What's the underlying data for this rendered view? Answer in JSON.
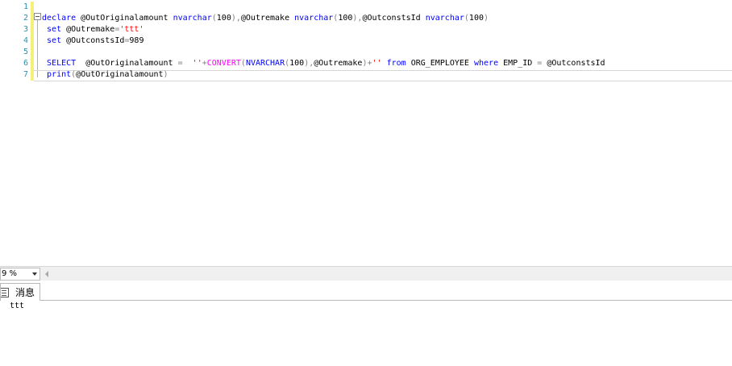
{
  "editor": {
    "line_numbers": [
      "1",
      "2",
      "3",
      "4",
      "5",
      "6",
      "7"
    ],
    "lines": [
      {
        "segments": []
      },
      {
        "segments": [
          {
            "t": "kw",
            "v": "declare"
          },
          {
            "t": "tx",
            "v": " @OutOriginalamount "
          },
          {
            "t": "kw",
            "v": "nvarchar"
          },
          {
            "t": "op",
            "v": "("
          },
          {
            "t": "tx",
            "v": "100"
          },
          {
            "t": "op",
            "v": "),"
          },
          {
            "t": "tx",
            "v": "@Outremake "
          },
          {
            "t": "kw",
            "v": "nvarchar"
          },
          {
            "t": "op",
            "v": "("
          },
          {
            "t": "tx",
            "v": "100"
          },
          {
            "t": "op",
            "v": "),"
          },
          {
            "t": "tx",
            "v": "@OutconstsId "
          },
          {
            "t": "kw",
            "v": "nvarchar"
          },
          {
            "t": "op",
            "v": "("
          },
          {
            "t": "tx",
            "v": "100"
          },
          {
            "t": "op",
            "v": ")"
          }
        ]
      },
      {
        "segments": [
          {
            "t": "tx",
            "v": " "
          },
          {
            "t": "kw",
            "v": "set"
          },
          {
            "t": "tx",
            "v": " @Outremake"
          },
          {
            "t": "op",
            "v": "="
          },
          {
            "t": "str",
            "v": "'ttt'"
          }
        ]
      },
      {
        "segments": [
          {
            "t": "tx",
            "v": " "
          },
          {
            "t": "kw",
            "v": "set"
          },
          {
            "t": "tx",
            "v": " @OutconstsId"
          },
          {
            "t": "op",
            "v": "="
          },
          {
            "t": "tx",
            "v": "989"
          }
        ]
      },
      {
        "segments": []
      },
      {
        "segments": [
          {
            "t": "tx",
            "v": " "
          },
          {
            "t": "kw",
            "v": "SELECT"
          },
          {
            "t": "tx",
            "v": "  @OutOriginalamount "
          },
          {
            "t": "op",
            "v": "="
          },
          {
            "t": "tx",
            "v": "  "
          },
          {
            "t": "str",
            "v": "''"
          },
          {
            "t": "op",
            "v": "+"
          },
          {
            "t": "fn",
            "v": "CONVERT"
          },
          {
            "t": "op",
            "v": "("
          },
          {
            "t": "kw",
            "v": "NVARCHAR"
          },
          {
            "t": "op",
            "v": "("
          },
          {
            "t": "tx",
            "v": "100"
          },
          {
            "t": "op",
            "v": "),"
          },
          {
            "t": "tx",
            "v": "@Outremake"
          },
          {
            "t": "op",
            "v": ")+"
          },
          {
            "t": "str",
            "v": "''"
          },
          {
            "t": "tx",
            "v": " "
          },
          {
            "t": "kw",
            "v": "from"
          },
          {
            "t": "tx",
            "v": " ORG_EMPLOYEE "
          },
          {
            "t": "kw",
            "v": "where"
          },
          {
            "t": "tx",
            "v": " EMP_ID "
          },
          {
            "t": "op",
            "v": "="
          },
          {
            "t": "tx",
            "v": " @OutconstsId"
          }
        ]
      },
      {
        "segments": [
          {
            "t": "tx",
            "v": " "
          },
          {
            "t": "kw",
            "v": "print"
          },
          {
            "t": "op",
            "v": "("
          },
          {
            "t": "tx",
            "v": "@OutOriginalamount"
          },
          {
            "t": "op",
            "v": ")"
          }
        ]
      }
    ]
  },
  "zoom": {
    "value": "9 %"
  },
  "results": {
    "tab_label": "消息",
    "tab_icon": "messages-icon",
    "output": [
      "ttt"
    ]
  },
  "colors": {
    "keyword": "#0000ff",
    "function": "#ff00ff",
    "string": "#ff0000",
    "operator": "#808080",
    "line_number": "#2b91af",
    "changed_line_marker": "#f5f07a"
  }
}
